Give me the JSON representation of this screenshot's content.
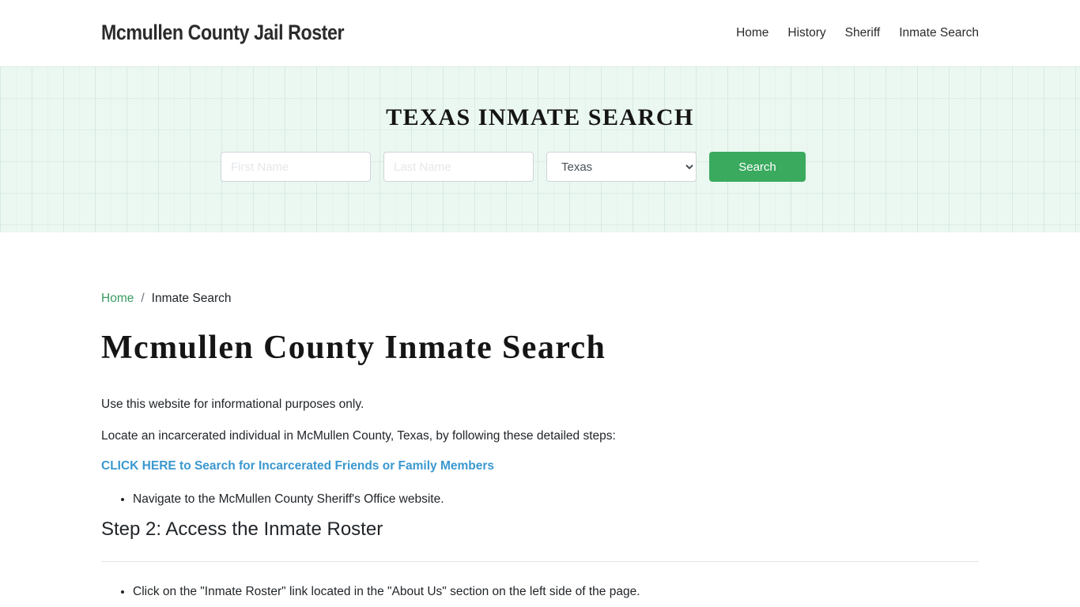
{
  "header": {
    "brand": "Mcmullen County Jail Roster",
    "nav": [
      "Home",
      "History",
      "Sheriff",
      "Inmate Search"
    ]
  },
  "hero": {
    "title": "TEXAS INMATE SEARCH",
    "first_name_placeholder": "First Name",
    "last_name_placeholder": "Last Name",
    "state_selected": "Texas",
    "search_label": "Search"
  },
  "breadcrumb": {
    "home": "Home",
    "separator": "/",
    "current": "Inmate Search"
  },
  "main": {
    "title": "Mcmullen County Inmate Search",
    "para1": "Use this website for informational purposes only.",
    "para2": "Locate an incarcerated individual in McMullen County, Texas, by following these detailed steps:",
    "cta": "CLICK HERE to Search for Incarcerated Friends or Family Members",
    "list1": [
      "Navigate to the McMullen County Sheriff's Office website."
    ],
    "step2_heading": "Step 2: Access the Inmate Roster",
    "list2": [
      "Click on the \"Inmate Roster\" link located in the \"About Us\" section on the left side of the page."
    ]
  },
  "colors": {
    "accent_green": "#3aaa5f",
    "link_blue": "#3a98cf",
    "breadcrumb_green": "#3a9b63",
    "hero_bg": "#ebf8f1"
  }
}
